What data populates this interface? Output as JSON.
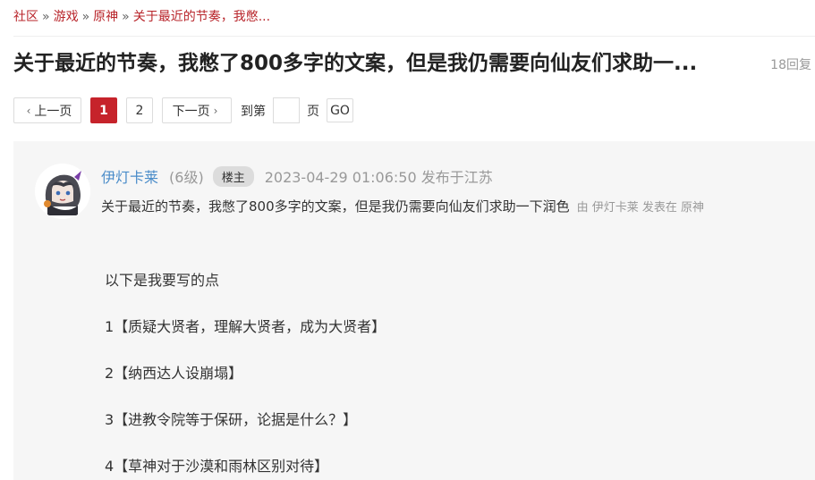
{
  "breadcrumb": {
    "items": [
      "社区",
      "游戏",
      "原神",
      "关于最近的节奏，我憋..."
    ],
    "separator": "»"
  },
  "thread": {
    "title": "关于最近的节奏，我憋了800多字的文案，但是我仍需要向仙友们求助一...",
    "reply_count": "18回复"
  },
  "pager": {
    "prev": "上一页",
    "pages": [
      "1",
      "2"
    ],
    "current": "1",
    "next": "下一页",
    "goto_label": "到第",
    "page_label": "页",
    "go": "GO"
  },
  "post": {
    "username": "伊灯卡莱",
    "level": "(6级)",
    "badge": "楼主",
    "datetime": "2023-04-29 01:06:50 发布于江苏",
    "subtitle": "关于最近的节奏，我憋了800多字的文案，但是我仍需要向仙友们求助一下润色",
    "byline": "由  伊灯卡莱 发表在  原神",
    "paragraphs": [
      "以下是我要写的点",
      "1【质疑大贤者，理解大贤者，成为大贤者】",
      "2【纳西达人设崩塌】",
      "3【进教令院等于保研，论据是什么？】",
      "4【草神对于沙漠和雨林区别对待】"
    ]
  },
  "colors": {
    "accent": "#c6232b",
    "link": "#b8242a",
    "username": "#4a8cc9",
    "post_bg": "#f6f6f6"
  }
}
